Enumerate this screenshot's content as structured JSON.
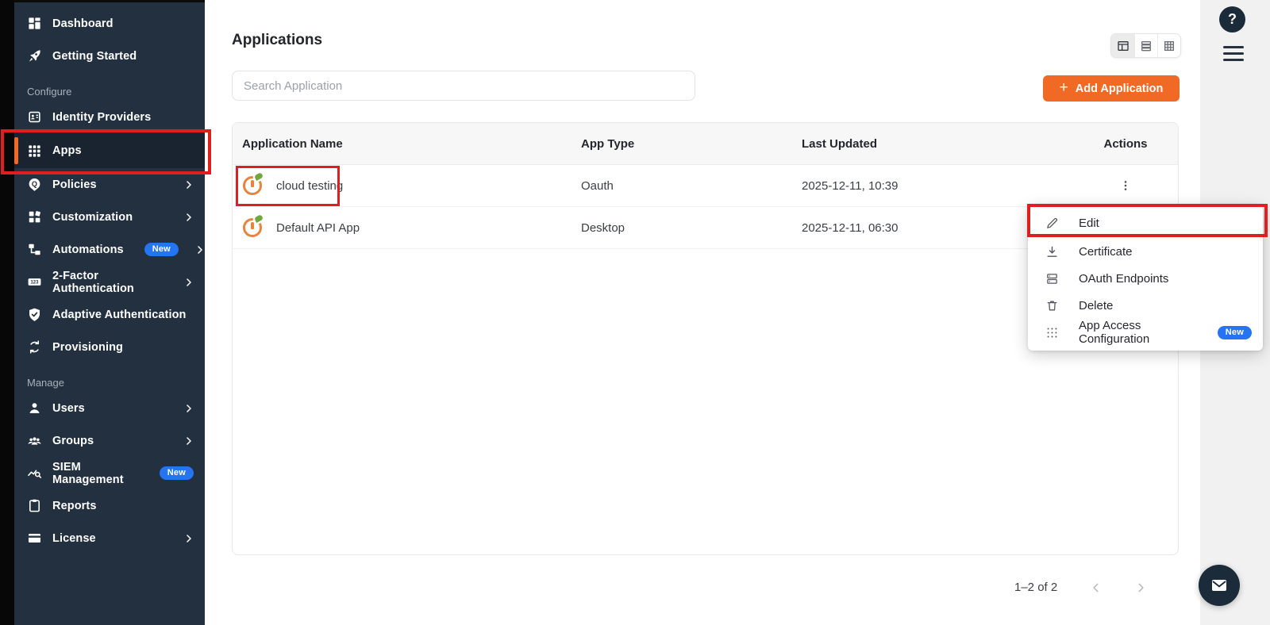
{
  "app": {
    "help_label": "?"
  },
  "colors": {
    "accent_orange": "#F06A26",
    "annotation_red": "#E01E20",
    "badge_blue": "#2574F2",
    "sidebar_bg": "#22303F",
    "sidebar_active_bg": "#192430",
    "dark_circle": "#1C2B3A"
  },
  "sidebar": {
    "items": [
      {
        "label": "Dashboard"
      },
      {
        "label": "Getting Started"
      },
      {
        "label": "Configure"
      },
      {
        "label": "Identity Providers"
      },
      {
        "label": "Apps"
      },
      {
        "label": "Policies"
      },
      {
        "label": "Customization"
      },
      {
        "label": "Automations",
        "badge": "New"
      },
      {
        "label": "2-Factor Authentication"
      },
      {
        "label": "Adaptive Authentication"
      },
      {
        "label": "Provisioning"
      },
      {
        "label": "Manage"
      },
      {
        "label": "Users"
      },
      {
        "label": "Groups"
      },
      {
        "label": "SIEM Management",
        "badge": "New"
      },
      {
        "label": "Reports"
      },
      {
        "label": "License"
      }
    ]
  },
  "header": {
    "title": "Applications"
  },
  "search": {
    "placeholder": "Search Application"
  },
  "toolbar": {
    "add_button": "Add Application",
    "plus": "+"
  },
  "table": {
    "columns": [
      "Application Name",
      "App Type",
      "Last Updated",
      "Actions"
    ],
    "rows": [
      {
        "name": "cloud testing",
        "type": "Oauth",
        "updated": "2025-12-11, 10:39"
      },
      {
        "name": "Default API App",
        "type": "Desktop",
        "updated": "2025-12-11, 06:30"
      }
    ]
  },
  "menu": {
    "items": [
      {
        "label": "Edit"
      },
      {
        "label": "Certificate"
      },
      {
        "label": "OAuth Endpoints"
      },
      {
        "label": "Delete"
      },
      {
        "label": "App Access Configuration",
        "badge": "New"
      }
    ]
  },
  "pagination": {
    "range": "1–2 of 2"
  }
}
